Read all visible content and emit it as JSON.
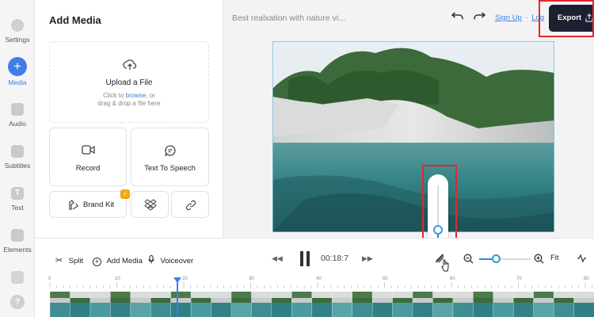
{
  "sidebar": {
    "items": [
      {
        "label": "Settings",
        "icon": "gear-icon"
      },
      {
        "label": "Media",
        "icon": "plus-icon"
      },
      {
        "label": "Audio",
        "icon": "music-note-icon"
      },
      {
        "label": "Subtitles",
        "icon": "subtitles-icon"
      },
      {
        "label": "Text",
        "icon": "text-icon"
      },
      {
        "label": "Elements",
        "icon": "elements-icon"
      }
    ],
    "accent": "#3f7de8"
  },
  "panel": {
    "title": "Add Media",
    "upload": {
      "title": "Upload a File",
      "line1_prefix": "Click to ",
      "browse": "browse",
      "line1_suffix": ", or",
      "line2": "drag & drop a file here"
    },
    "record": "Record",
    "tts": "Text To Speech",
    "brand_kit": "Brand Kit"
  },
  "header": {
    "project_title": "Best realxation with nature vi...",
    "sign_up": "Sign Up",
    "separator": "·",
    "log": "Log",
    "export": "Export"
  },
  "toolbar": {
    "split": "Split",
    "add_media": "Add Media",
    "voiceover": "Voiceover",
    "time": "00:18:7",
    "fit": "Fit",
    "zoom_level": 0.32,
    "volume_level": 0.3
  },
  "timeline": {
    "ruler_labels": [
      "0",
      "10",
      "20",
      "30",
      "40",
      "50",
      "60",
      "70",
      "80"
    ],
    "playhead_at": 19
  }
}
